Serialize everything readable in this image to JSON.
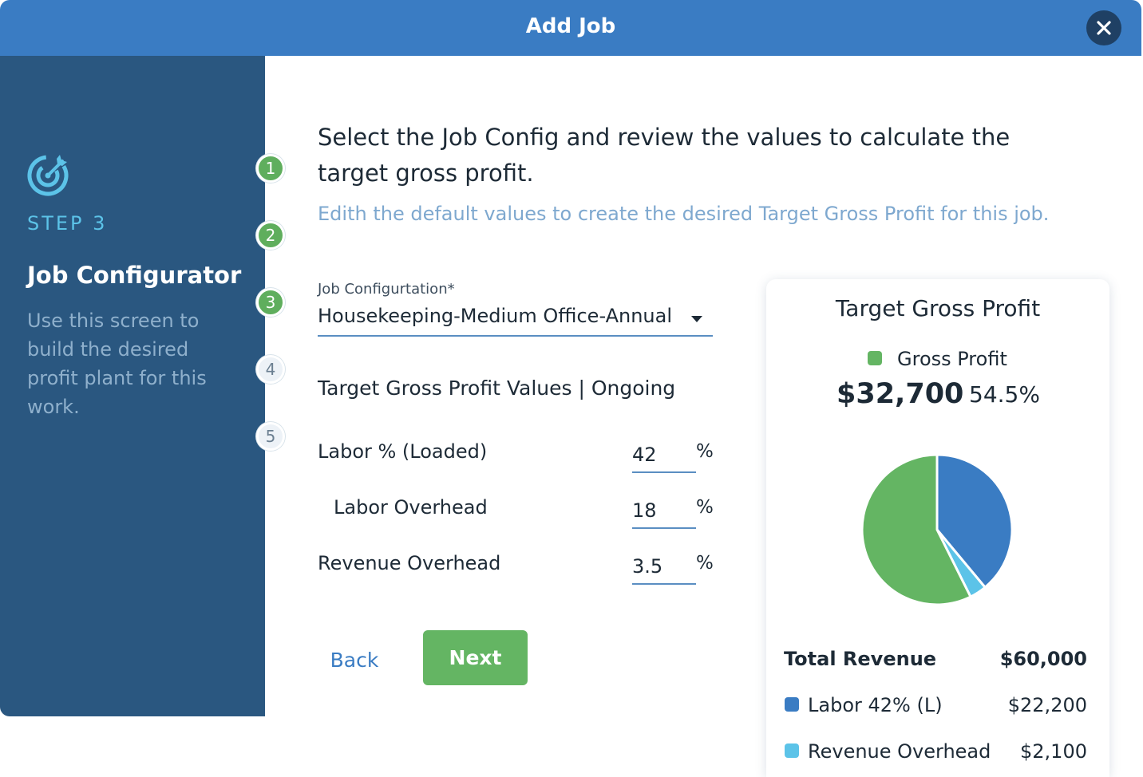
{
  "dialog": {
    "title": "Add Job"
  },
  "sidebar": {
    "step_label": "STEP 3",
    "title": "Job Configurator",
    "description": "Use this screen to build the desired profit plant for this work."
  },
  "steps": [
    {
      "number": "1",
      "state": "done"
    },
    {
      "number": "2",
      "state": "done"
    },
    {
      "number": "3",
      "state": "done"
    },
    {
      "number": "4",
      "state": "todo"
    },
    {
      "number": "5",
      "state": "todo"
    }
  ],
  "main": {
    "heading": "Select the Job Config and review the values to calculate the target gross profit.",
    "subheading": "Edith the default values to create the desired Target Gross Profit for this job.",
    "job_config": {
      "label": "Job Configurtation*",
      "value": "Housekeeping-Medium Office-Annual"
    },
    "section_title": "Target Gross Profit Values | Ongoing",
    "fields": [
      {
        "label": "Labor % (Loaded)",
        "value": "42",
        "unit": "%"
      },
      {
        "label": "Labor Overhead",
        "value": "18",
        "unit": "%"
      },
      {
        "label": "Revenue Overhead",
        "value": "3.5",
        "unit": "%"
      }
    ],
    "back_label": "Back",
    "next_label": "Next"
  },
  "summary": {
    "title": "Target Gross Profit",
    "legend_label": "Gross Profit",
    "gross_profit_amount": "$32,700",
    "gross_profit_pct": "54.5%",
    "total_revenue_label": "Total Revenue",
    "total_revenue_value": "$60,000",
    "line_items": [
      {
        "label": "Labor 42% (L)",
        "value": "$22,200",
        "color": "#3a7cc3"
      },
      {
        "label": "Revenue Overhead",
        "value": "$2,100",
        "color": "#5cc3e8"
      }
    ]
  },
  "chart_data": {
    "type": "pie",
    "slices": [
      {
        "name": "Labor",
        "value": 22200,
        "color": "#3a7cc3"
      },
      {
        "name": "Revenue Overhead",
        "value": 2100,
        "color": "#5cc3e8"
      },
      {
        "name": "Gross Profit",
        "value": 32700,
        "color": "#64b563"
      }
    ]
  },
  "colors": {
    "header": "#3a7cc3",
    "sidebar": "#2a5780",
    "accent_green": "#64b563",
    "accent_cyan": "#5cc3e8"
  },
  "icons": {
    "sidebar_icon": "target-icon",
    "close": "close-icon",
    "select_caret": "caret-down-icon"
  }
}
